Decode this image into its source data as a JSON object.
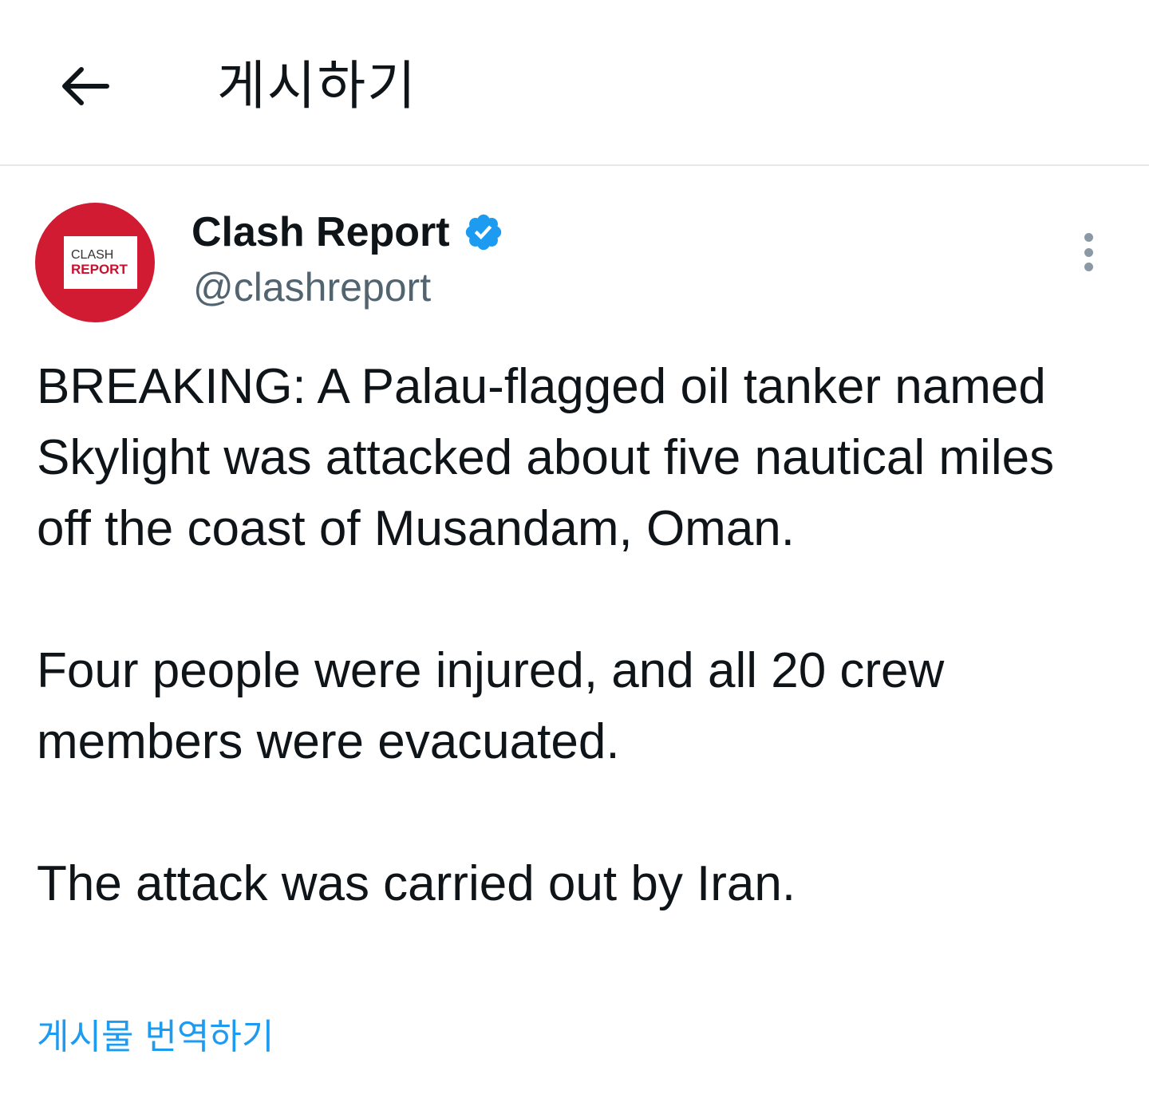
{
  "header": {
    "title": "게시하기",
    "back_icon": "arrow-left-icon"
  },
  "author": {
    "display_name": "Clash Report",
    "handle": "@clashreport",
    "verified": true,
    "avatar_line1": "CLASH",
    "avatar_line2": "REPORT"
  },
  "post": {
    "paragraphs": [
      "BREAKING: A Palau-flagged oil tanker named Skylight was attacked about five nautical miles off the coast of Musandam, Oman.",
      "Four people were injured, and all 20 crew members were evacuated.",
      "The attack was carried out by Iran."
    ],
    "translate_label": "게시물 번역하기"
  },
  "colors": {
    "text": "#0f1419",
    "secondary_text": "#536471",
    "link": "#1d9bf0",
    "verified": "#1d9bf0",
    "avatar_bg": "#d01b32"
  }
}
